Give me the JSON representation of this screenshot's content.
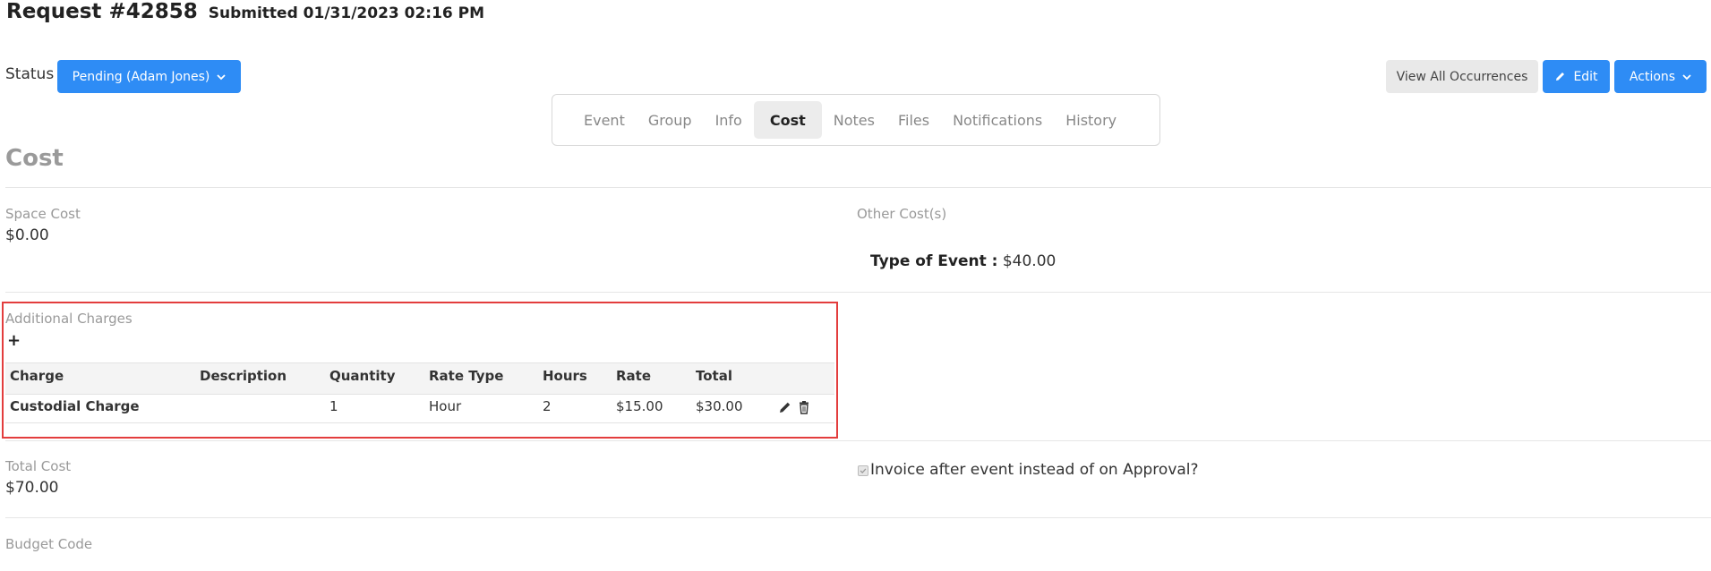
{
  "header": {
    "title": "Request #42858",
    "submitted": "Submitted 01/31/2023 02:16 PM"
  },
  "status": {
    "label": "Status",
    "value": "Pending (Adam Jones)"
  },
  "toolbar": {
    "view_all": "View All Occurrences",
    "edit": "Edit",
    "actions": "Actions"
  },
  "tabs": [
    {
      "label": "Event"
    },
    {
      "label": "Group"
    },
    {
      "label": "Info"
    },
    {
      "label": "Cost"
    },
    {
      "label": "Notes"
    },
    {
      "label": "Files"
    },
    {
      "label": "Notifications"
    },
    {
      "label": "History"
    }
  ],
  "active_tab": "Cost",
  "cost": {
    "heading": "Cost",
    "space_cost_label": "Space Cost",
    "space_cost_value": "$0.00",
    "other_costs_label": "Other Cost(s)",
    "type_of_event_label": "Type of Event :",
    "type_of_event_value": "$40.00",
    "additional_charges_label": "Additional Charges",
    "add_symbol": "+",
    "table": {
      "columns": [
        "Charge",
        "Description",
        "Quantity",
        "Rate Type",
        "Hours",
        "Rate",
        "Total"
      ],
      "rows": [
        {
          "charge": "Custodial Charge",
          "description": "",
          "quantity": "1",
          "rate_type": "Hour",
          "hours": "2",
          "rate": "$15.00",
          "total": "$30.00"
        }
      ]
    },
    "total_cost_label": "Total Cost",
    "total_cost_value": "$70.00",
    "invoice_label": "Invoice after event instead of on Approval?",
    "invoice_checked": true,
    "budget_code_label": "Budget Code"
  },
  "icons": [
    "chevron-down-icon",
    "pencil-icon",
    "trash-icon",
    "checkbox-icon"
  ],
  "colors": {
    "primary": "#2e8cf5",
    "highlight_border": "#e33d3d",
    "heading_gray": "#9a9a9a"
  }
}
